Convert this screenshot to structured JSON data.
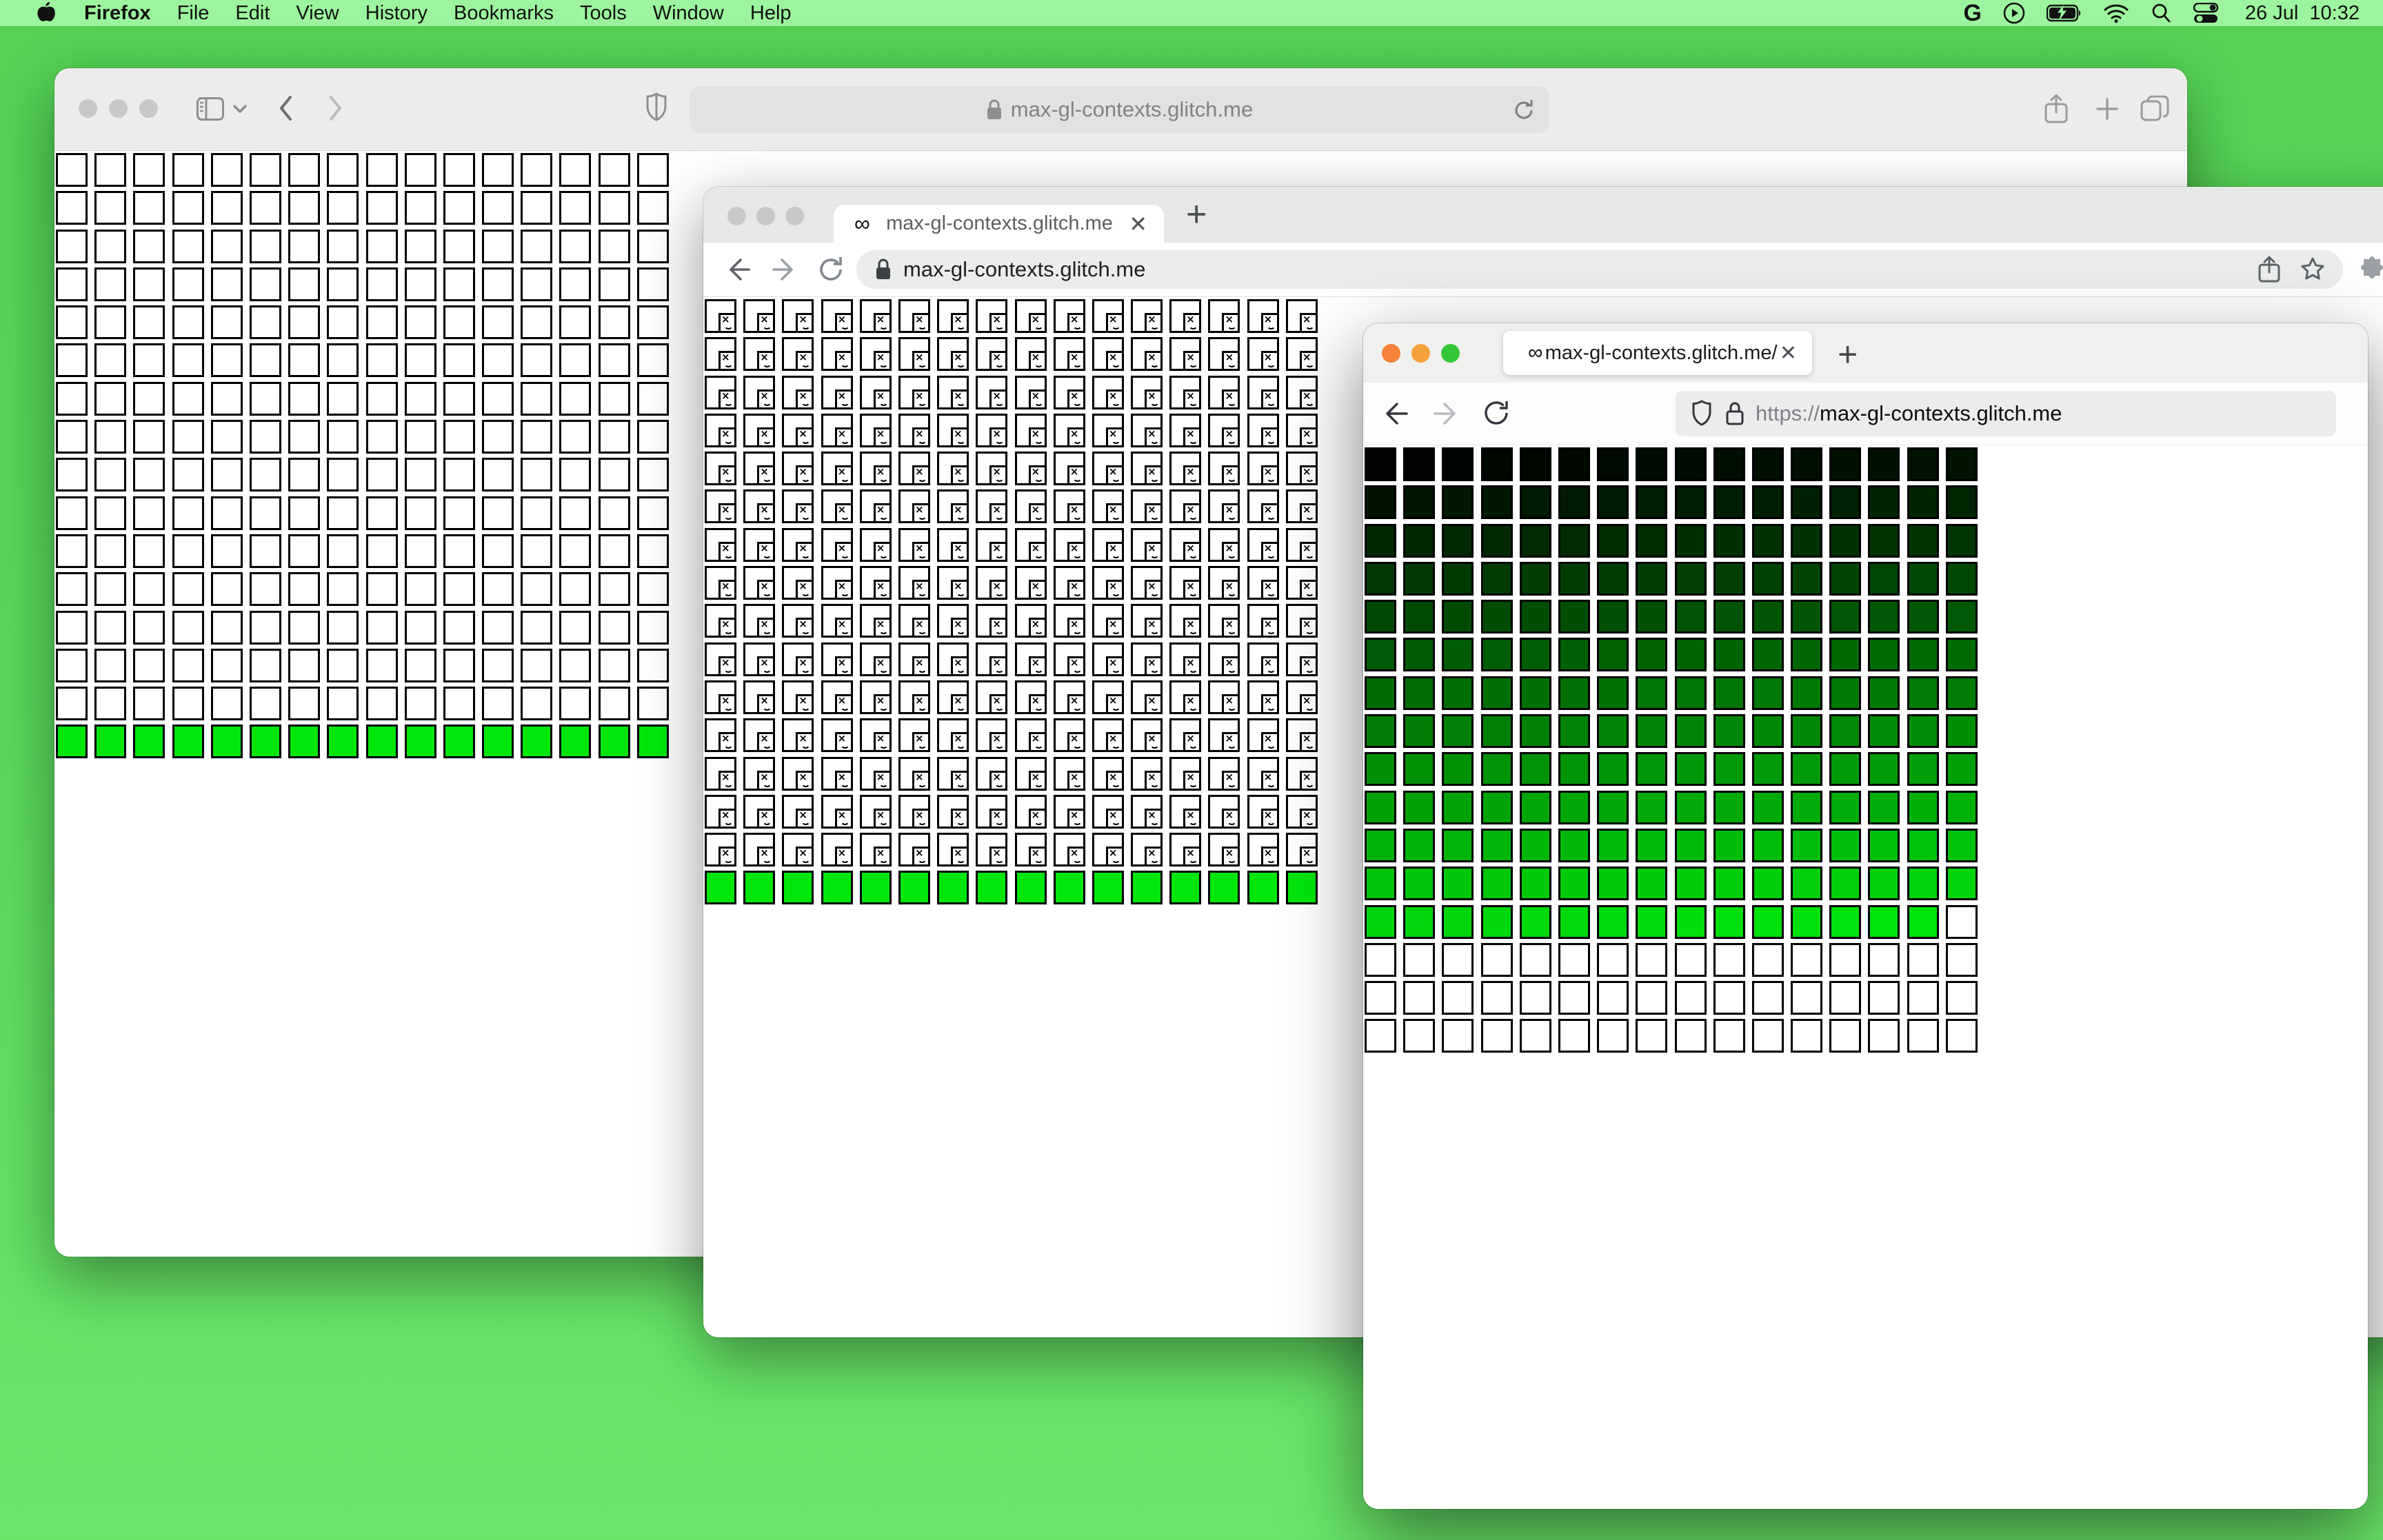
{
  "menu_bar": {
    "app_name": "Firefox",
    "menus": [
      "File",
      "Edit",
      "View",
      "History",
      "Bookmarks",
      "Tools",
      "Window",
      "Help"
    ],
    "status": {
      "date": "26 Jul",
      "time": "10:32"
    },
    "status_icons": [
      "google-g-icon",
      "play-circle-icon",
      "battery-charging-icon",
      "wifi-icon",
      "search-icon",
      "control-center-icon"
    ],
    "left_icons": [
      "apple-icon"
    ]
  },
  "windows": {
    "safari": {
      "browser": "Safari",
      "url": "max-gl-contexts.glitch.me",
      "toolbar_icons": [
        "sidebar-icon",
        "chevron-down-icon",
        "back-icon",
        "forward-icon",
        "shield-icon",
        "lock-icon",
        "reload-icon",
        "share-icon",
        "new-tab-icon",
        "tab-overview-icon"
      ]
    },
    "chrome": {
      "browser": "Chrome",
      "tab_label": "max-gl-contexts.glitch.me",
      "favicon": "∞",
      "tab_close": "✕",
      "new_tab": "+",
      "url": "max-gl-contexts.glitch.me",
      "toolbar_icons": [
        "back-icon",
        "forward-icon",
        "reload-icon",
        "lock-icon",
        "share-icon",
        "star-icon",
        "extensions-puzzle-icon"
      ]
    },
    "firefox": {
      "browser": "Firefox",
      "tab_label": "max-gl-contexts.glitch.me/",
      "favicon": "∞",
      "tab_close": "✕",
      "new_tab": "+",
      "url_scheme": "https://",
      "url_host": "max-gl-contexts.glitch.me",
      "toolbar_icons": [
        "back-icon",
        "forward-icon",
        "reload-icon",
        "shield-icon",
        "lock-icon"
      ]
    }
  },
  "grids": {
    "cols": 16,
    "rows": 16,
    "green": "#00e60b",
    "windows": {
      "safari": {
        "kind": "blank",
        "last_row_green": true,
        "description": "15 rows empty white canvases, last row filled green"
      },
      "chrome": {
        "kind": "broken",
        "last_row_green": true,
        "description": "15 rows broken-image canvases, last row filled green"
      },
      "firefox": {
        "kind": "gradient",
        "last_row_green": false,
        "colored_cells": 207,
        "g_start": 3,
        "g_end": 228,
        "description": "207 canvases shading black to bright green, remaining 49 white"
      }
    }
  },
  "colors": {
    "desktop_green": "#5bd95b",
    "menubar_green": "#9cf59e",
    "canvas_green": "#00e60b",
    "traffic_gray": "#c8c8c6",
    "firefox_traffic": [
      "#f5813b",
      "#f5a13b",
      "#35c638"
    ]
  }
}
